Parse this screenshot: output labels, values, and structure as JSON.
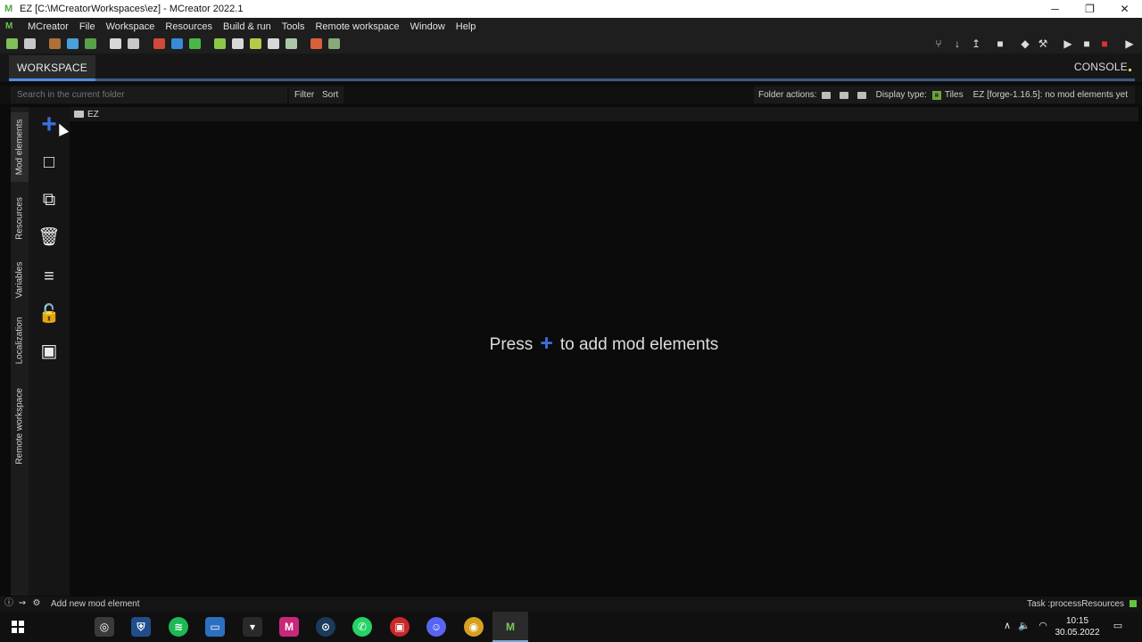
{
  "window": {
    "title": "EZ [C:\\MCreatorWorkspaces\\ez]  - MCreator 2022.1",
    "app_icon": "mcreator-icon",
    "controls": {
      "minimize": "─",
      "maximize": "❐",
      "close": "✕"
    }
  },
  "menu": {
    "logo_icon": "mcreator-logo-icon",
    "items": [
      "MCreator",
      "File",
      "Workspace",
      "Resources",
      "Build & run",
      "Tools",
      "Remote workspace",
      "Window",
      "Help"
    ]
  },
  "toolbar": {
    "left_icons": [
      "workspace-settings-icon",
      "open-workspace-icon",
      "block-icon",
      "item-icon",
      "biome-icon",
      "export-icon",
      "import-icon",
      "texture-red-icon",
      "texture-blue-icon",
      "texture-green-icon",
      "model-icon",
      "armor-icon",
      "structure-icon",
      "recipe-icon",
      "animation-icon",
      "gradle-icon",
      "link-icon"
    ],
    "right_icons": [
      "git-branch-icon",
      "pull-icon",
      "push-icon",
      "build-icon",
      "regenerate-icon",
      "hammer-icon",
      "run-client-icon",
      "stop-icon",
      "stop-red-icon",
      "export-mod-icon"
    ]
  },
  "tabs": {
    "workspace_label": "WORKSPACE",
    "console_label": "CONSOLE"
  },
  "search": {
    "placeholder": "Search in the current folder",
    "filter_label": "Filter",
    "sort_label": "Sort",
    "folder_actions_label": "Folder actions:",
    "display_type_label": "Display type:",
    "tiles_label": "Tiles",
    "workspace_info": "EZ [forge-1.16.5]: no mod elements yet"
  },
  "side_tabs": [
    "Mod elements",
    "Resources",
    "Variables",
    "Localization",
    "Remote workspace"
  ],
  "tools": [
    "add-element-icon",
    "edit-element-icon",
    "duplicate-element-icon",
    "delete-element-icon",
    "code-edit-icon",
    "lock-element-icon",
    "element-id-icon"
  ],
  "main": {
    "folder_name": "EZ",
    "empty_prefix": "Press",
    "empty_plus": "+",
    "empty_suffix": "to add mod elements"
  },
  "status": {
    "hint": "Add new mod element",
    "task": "Task :processResources",
    "task_color": "#64c43e"
  },
  "taskbar": {
    "apps": [
      "safari-icon",
      "security-icon",
      "spotify-icon",
      "explorer-icon",
      "epic-games-icon",
      "media-app-icon",
      "steam-icon",
      "whatsapp-icon",
      "red-app-icon",
      "discord-icon",
      "chrome-icon",
      "mcreator-taskbar-icon"
    ],
    "time": "10:15",
    "date": "30.05.2022"
  },
  "colors": {
    "accent_blue": "#3c6fe0",
    "tab_underline": "#4f8fe0",
    "background": "#0b0b0b"
  }
}
